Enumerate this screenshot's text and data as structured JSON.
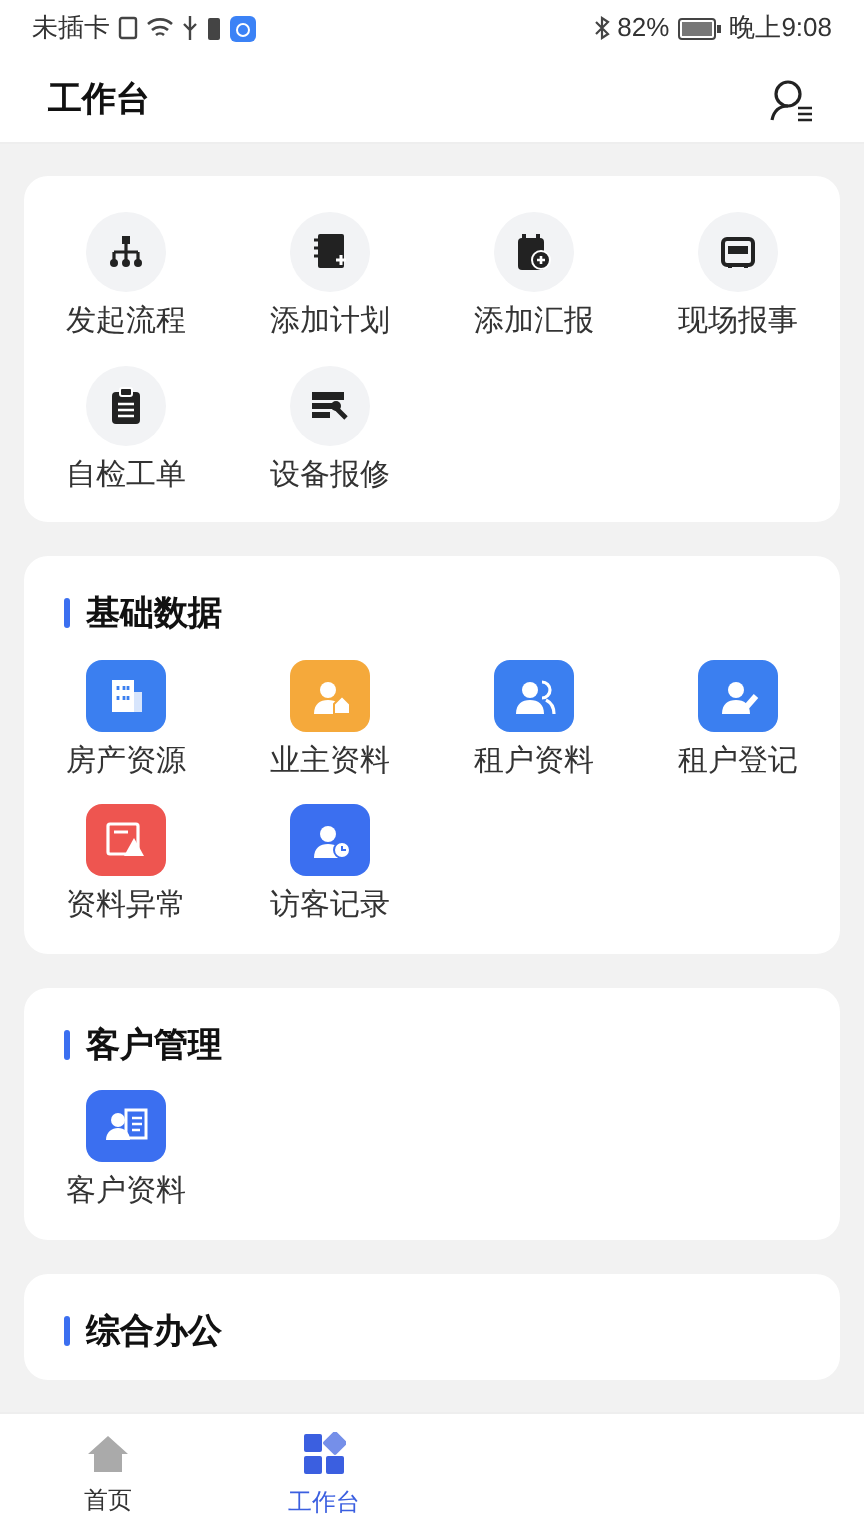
{
  "status_bar": {
    "carrier": "未插卡",
    "battery": "82%",
    "time": "晚上9:08"
  },
  "header": {
    "title": "工作台"
  },
  "quick_actions": [
    {
      "label": "发起流程"
    },
    {
      "label": "添加计划"
    },
    {
      "label": "添加汇报"
    },
    {
      "label": "现场报事"
    },
    {
      "label": "自检工单"
    },
    {
      "label": "设备报修"
    }
  ],
  "sections": [
    {
      "title": "基础数据",
      "items": [
        {
          "label": "房产资源",
          "color": "#3b7ff0"
        },
        {
          "label": "业主资料",
          "color": "#f5a93b"
        },
        {
          "label": "租户资料",
          "color": "#3b7ff0"
        },
        {
          "label": "租户登记",
          "color": "#3b7ff0"
        },
        {
          "label": "资料异常",
          "color": "#ee5550"
        },
        {
          "label": "访客记录",
          "color": "#3b6ff0"
        }
      ]
    },
    {
      "title": "客户管理",
      "items": [
        {
          "label": "客户资料",
          "color": "#3b6ff0"
        }
      ]
    },
    {
      "title": "综合办公"
    }
  ],
  "tab_bar": [
    {
      "label": "首页",
      "selected": false
    },
    {
      "label": "工作台",
      "selected": true
    }
  ]
}
